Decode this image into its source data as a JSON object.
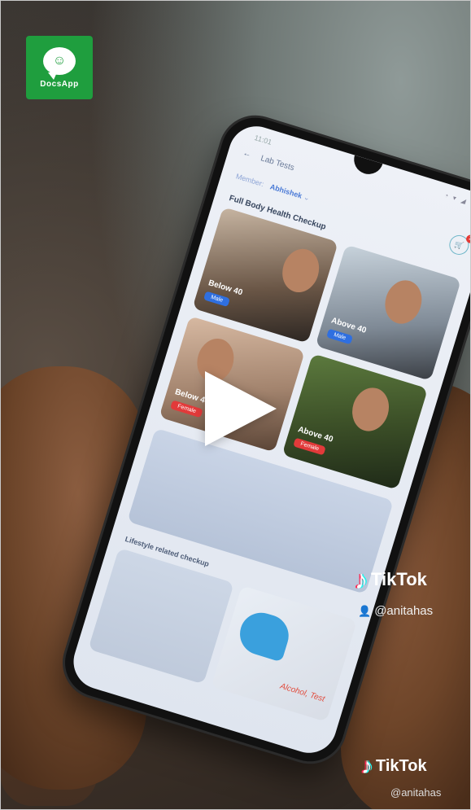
{
  "brand": {
    "logo_text": "DocsApp",
    "logo_color": "#1f9e3e"
  },
  "app_screen": {
    "status_time": "11:01",
    "status_icons": "◔ ▾ ◢ ▢",
    "header_title": "Lab Tests",
    "filter_label": "Member:",
    "filter_value": "Abhishek",
    "cart_count": "2",
    "section_title": "Full Body Health Checkup",
    "cards": [
      {
        "label": "Below 40",
        "tag": "Male"
      },
      {
        "label": "Above 40",
        "tag": "Male"
      },
      {
        "label": "Below 40",
        "tag": "Female"
      },
      {
        "label": "Above 40",
        "tag": "Female"
      }
    ],
    "lifestyle_title": "Lifestyle related checkup",
    "promo_text": "Alcohol, Test"
  },
  "player": {
    "play_icon": "play-icon"
  },
  "watermark": {
    "brand": "TikTok",
    "username_top": "@anitahas",
    "username_bottom": "@anitahas"
  }
}
